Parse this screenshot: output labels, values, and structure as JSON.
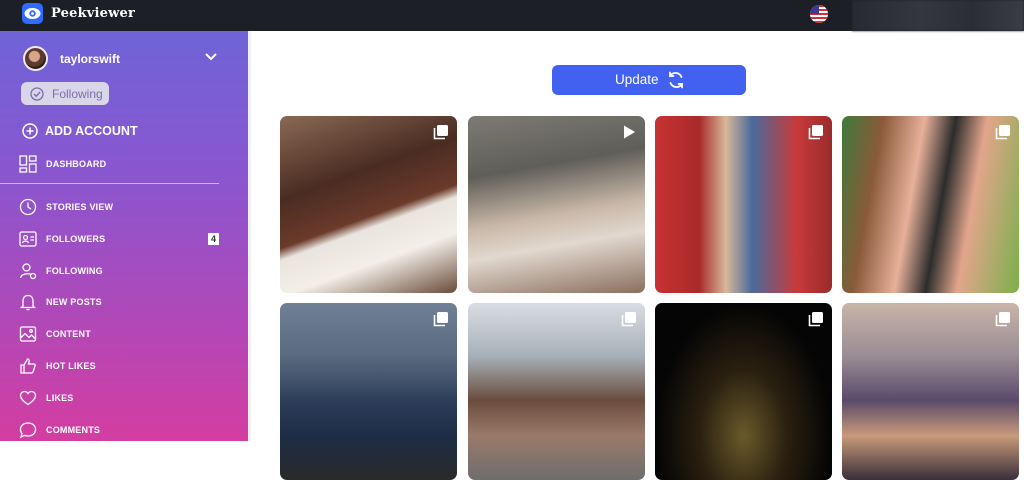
{
  "app": {
    "name": "Peekviewer"
  },
  "profile": {
    "username": "taylorswift",
    "follow_status": "Following"
  },
  "sidebar": {
    "add_account": "ADD ACCOUNT",
    "items": [
      {
        "label": "DASHBOARD",
        "icon": "dashboard-icon"
      },
      {
        "label": "STORIES VIEW",
        "icon": "clock-icon"
      },
      {
        "label": "FOLLOWERS",
        "icon": "followers-icon",
        "badge": "4"
      },
      {
        "label": "FOLLOWING",
        "icon": "following-icon"
      },
      {
        "label": "NEW POSTS",
        "icon": "bell-icon"
      },
      {
        "label": "CONTENT",
        "icon": "image-icon"
      },
      {
        "label": "HOT LIKES",
        "icon": "thumbs-up-icon"
      },
      {
        "label": "LIKES",
        "icon": "heart-icon"
      },
      {
        "label": "COMMENTS",
        "icon": "comment-icon"
      }
    ]
  },
  "main": {
    "update_label": "Update",
    "posts": [
      {
        "type": "carousel",
        "icon": "multiple-photos-icon"
      },
      {
        "type": "video",
        "icon": "play-icon"
      },
      {
        "type": "carousel",
        "icon": "multiple-photos-icon"
      },
      {
        "type": "carousel",
        "icon": "multiple-photos-icon"
      },
      {
        "type": "carousel",
        "icon": "multiple-photos-icon"
      },
      {
        "type": "carousel",
        "icon": "multiple-photos-icon"
      },
      {
        "type": "carousel",
        "icon": "multiple-photos-icon"
      },
      {
        "type": "carousel",
        "icon": "multiple-photos-icon"
      }
    ]
  },
  "colors": {
    "topbar": "#1c1f26",
    "accent": "#4361f0",
    "sidebar_top": "#6f63d8",
    "sidebar_bottom": "#d43da1"
  }
}
